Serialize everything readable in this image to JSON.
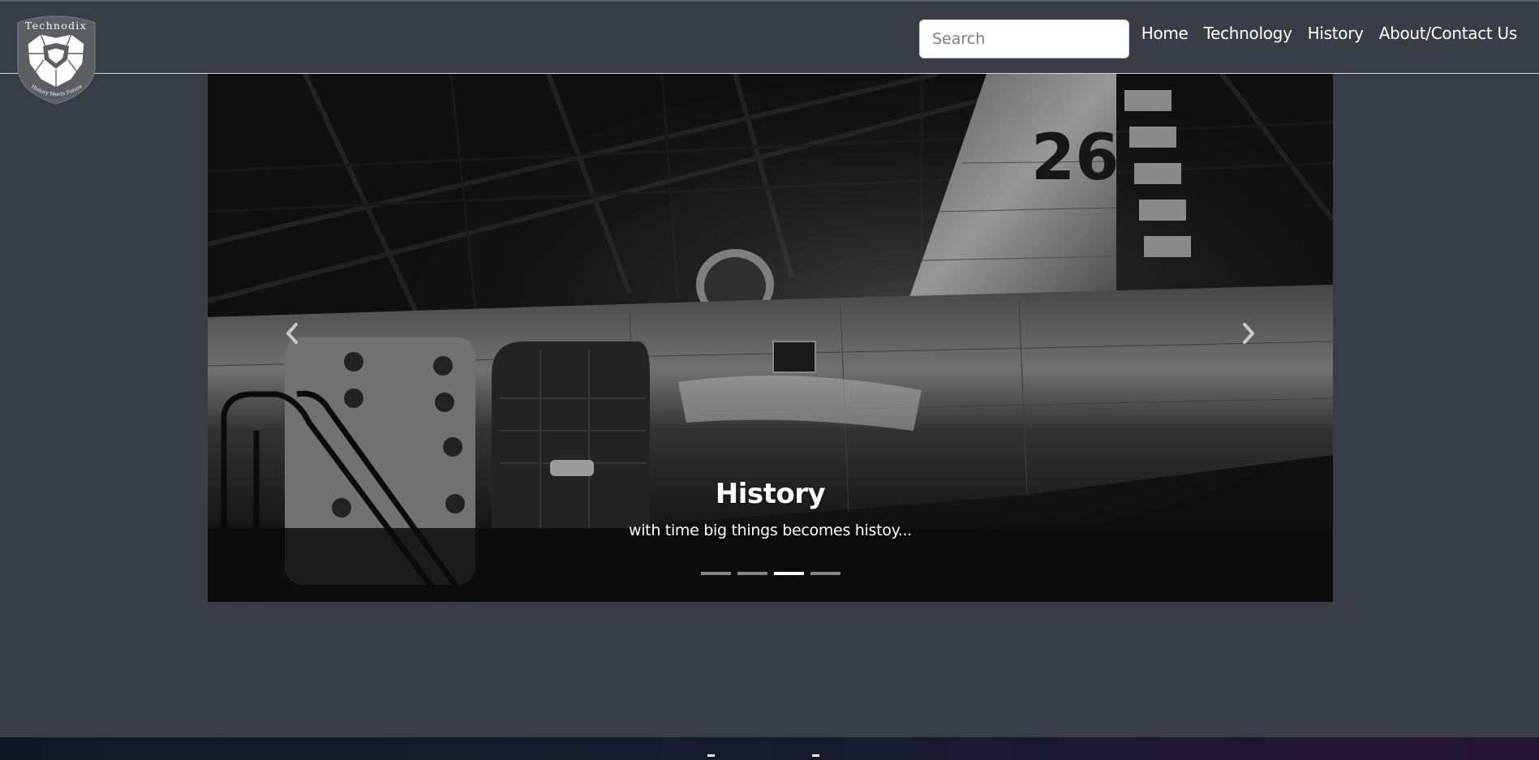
{
  "brand": {
    "name": "Technodix",
    "tagline": "History Meets Future"
  },
  "search": {
    "placeholder": "Search"
  },
  "nav": {
    "items": [
      "Home",
      "Technology",
      "History",
      "About/Contact Us"
    ]
  },
  "carousel": {
    "active_index": 2,
    "slide_count": 4,
    "caption_title": "History",
    "caption_text": "with time big things becomes histoy...",
    "image_subject": "vintage aircraft fuselage in hangar",
    "image_marking": "26"
  },
  "colors": {
    "page_background": "#373c45",
    "text": "#ffffff"
  }
}
